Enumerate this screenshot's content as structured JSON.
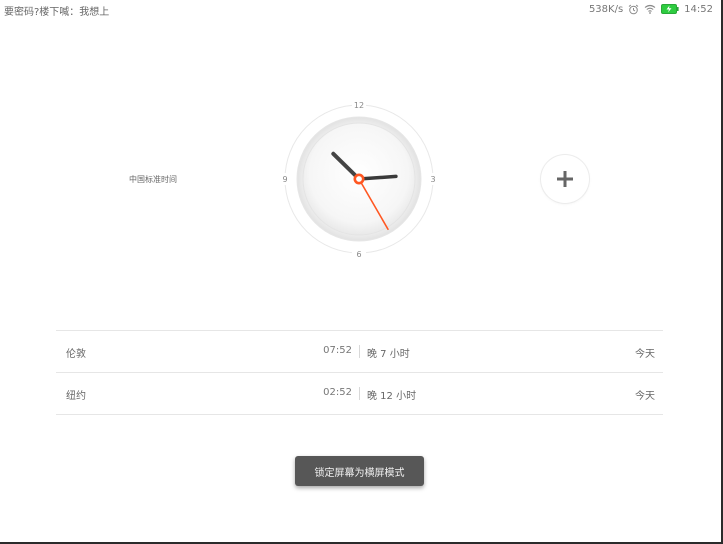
{
  "status_bar": {
    "left_text": "要密码?楼下喊：我想上",
    "network_speed": "538K/s",
    "time": "14:52",
    "icons": [
      "alarm-icon",
      "wifi-icon",
      "battery-charging-icon"
    ],
    "battery_color": "#2ecc40"
  },
  "clock": {
    "timezone_label": "中国标准时间",
    "dial_numbers": {
      "top": "12",
      "right": "3",
      "bottom": "6",
      "left": "9"
    },
    "time_shown": {
      "hour": 2,
      "minute": 52,
      "second": 25
    },
    "second_hand_color": "#ff5722"
  },
  "add_button": {
    "icon": "plus-icon"
  },
  "cities": [
    {
      "name": "伦敦",
      "time": "07:52",
      "diff": "晚 7 小时",
      "day": "今天"
    },
    {
      "name": "纽约",
      "time": "02:52",
      "diff": "晚 12 小时",
      "day": "今天"
    }
  ],
  "toast": {
    "text": "锁定屏幕为横屏模式"
  }
}
